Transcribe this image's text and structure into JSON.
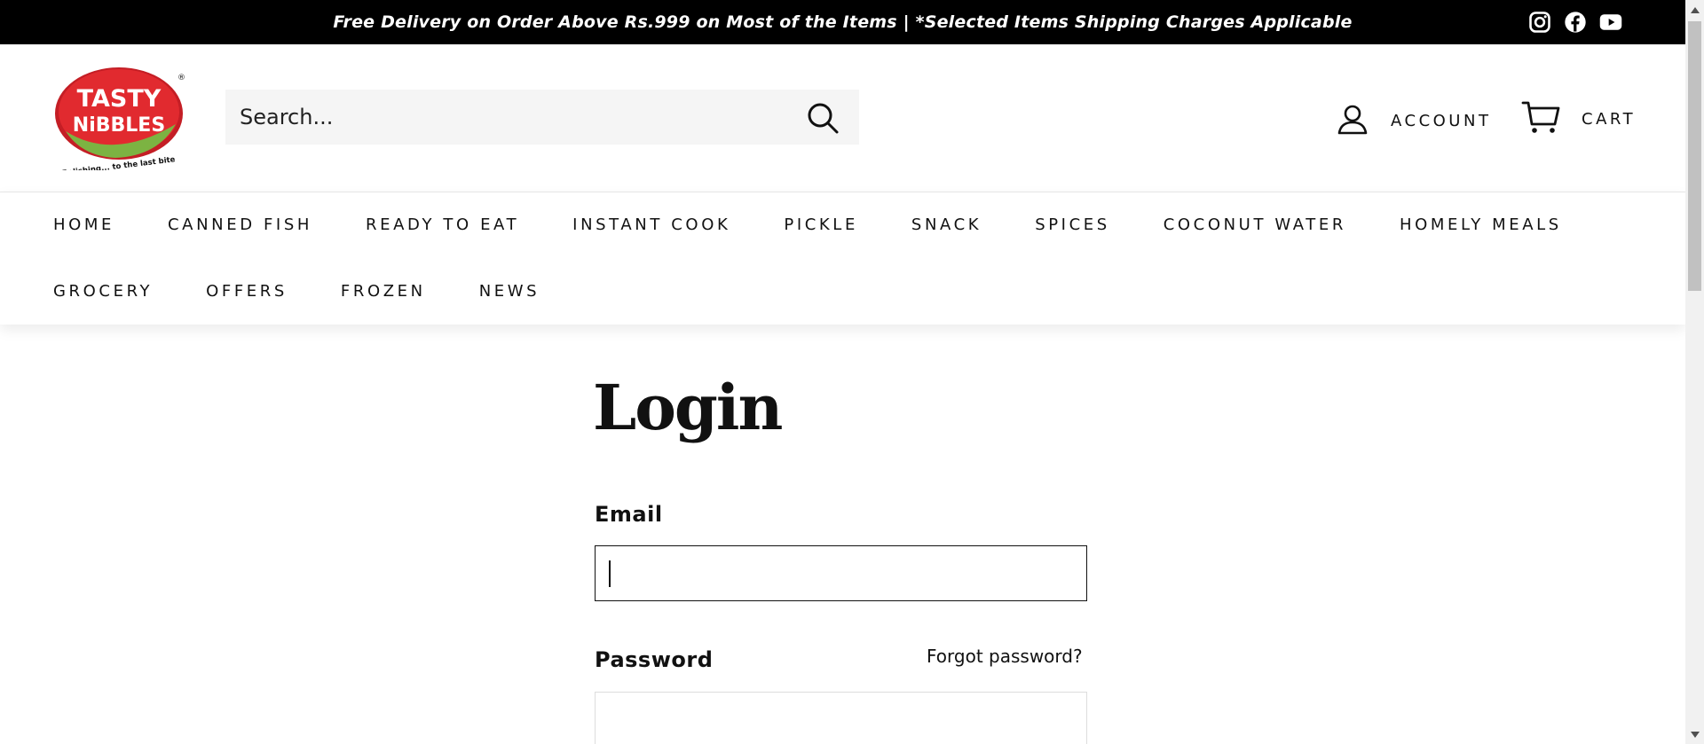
{
  "announcement": {
    "text": "Free Delivery on Order Above Rs.999 on Most of the Items | *Selected Items Shipping Charges Applicable",
    "social_icons": [
      "instagram-icon",
      "facebook-icon",
      "youtube-icon"
    ]
  },
  "header": {
    "logo": {
      "line1": "TASTY",
      "line2": "NiBBLES",
      "tagline": "Relishing... to the last bite",
      "registered": "®"
    },
    "search": {
      "placeholder": "Search..."
    },
    "account_label": "ACCOUNT",
    "cart_label": "CART"
  },
  "nav": {
    "row1": [
      "HOME",
      "CANNED FISH",
      "READY TO EAT",
      "INSTANT COOK",
      "PICKLE",
      "SNACK",
      "SPICES",
      "COCONUT WATER",
      "HOMELY MEALS"
    ],
    "row2": [
      "GROCERY",
      "OFFERS",
      "FROZEN",
      "NEWS"
    ]
  },
  "login": {
    "title": "Login",
    "email_label": "Email",
    "email_value": "",
    "password_label": "Password",
    "forgot_label": "Forgot password?"
  },
  "colors": {
    "announcement_bg": "#000000",
    "logo_red": "#d6202a",
    "logo_green": "#7cb342",
    "search_bg": "#f5f5f5"
  }
}
